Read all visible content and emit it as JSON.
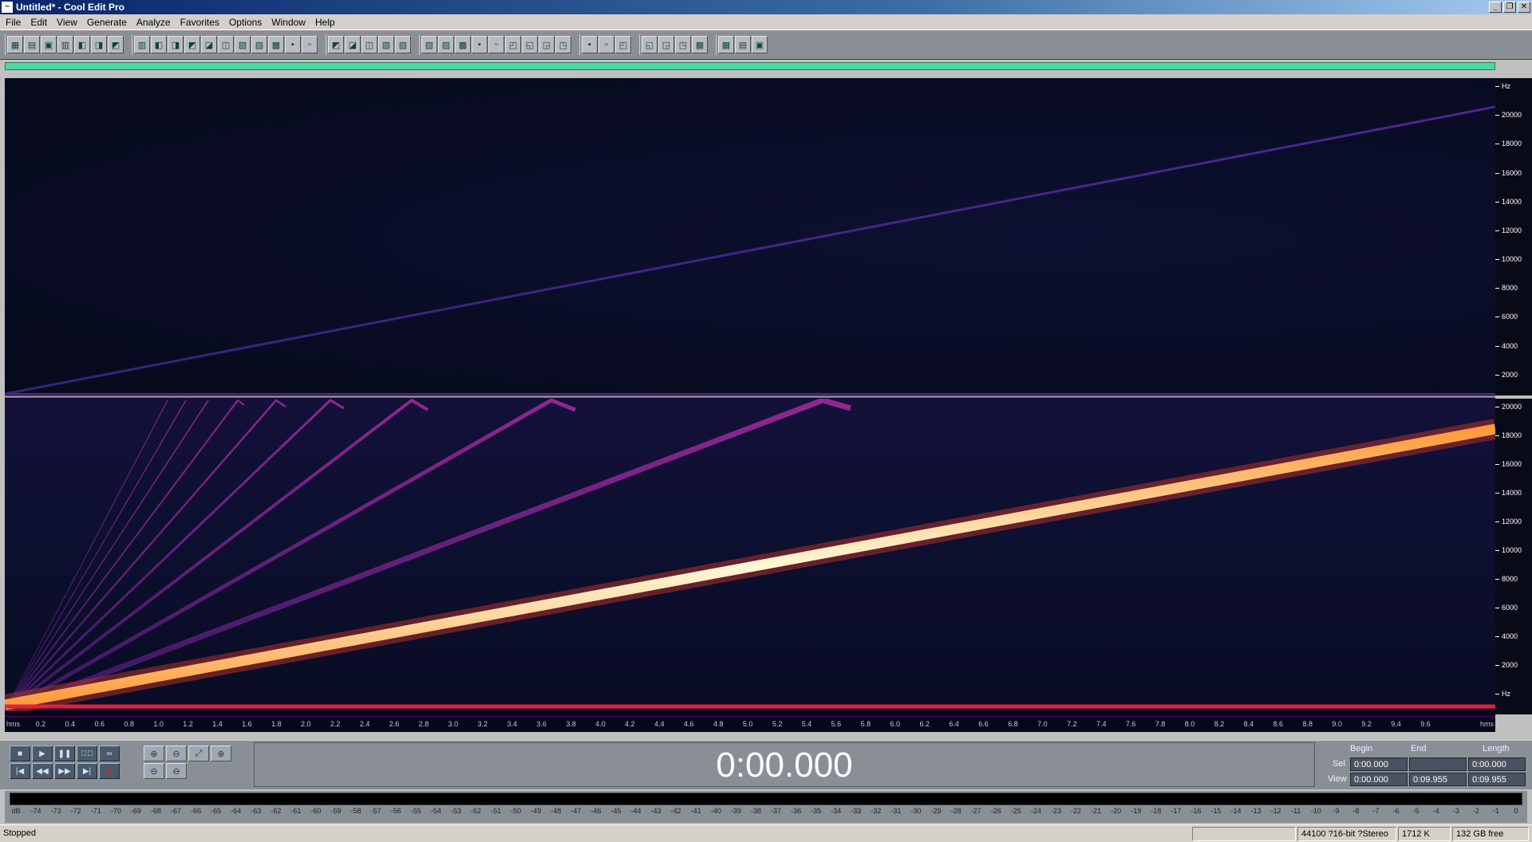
{
  "window": {
    "title": "Untitled* - Cool Edit Pro",
    "min": "_",
    "restore": "❐",
    "close": "✕"
  },
  "menu": [
    "File",
    "Edit",
    "View",
    "Generate",
    "Analyze",
    "Favorites",
    "Options",
    "Window",
    "Help"
  ],
  "toolbar": {
    "groups": [
      [
        "file-new",
        "open",
        "save",
        "save-all",
        "close-file",
        "insert",
        "mix-paste"
      ],
      [
        "undo",
        "redo",
        "repeat",
        "copy",
        "copy-new",
        "cut",
        "trim",
        "paste",
        "paste-new",
        "mix",
        "crossfade"
      ],
      [
        "waveform-view",
        "spectral-view",
        "pan-view",
        "phase-view",
        "stereo-view"
      ],
      [
        "cue-list",
        "play-list",
        "info",
        "play-loop",
        "zoom-view",
        "time-label",
        "frequency-analysis",
        "marker",
        "channel"
      ],
      [
        "wizard",
        "brainstorm",
        "help-context"
      ],
      [
        "fx-1",
        "fx-2",
        "fx-3",
        "fx-4"
      ],
      [
        "scripts",
        "brainstorm-2",
        "fullscreen"
      ]
    ]
  },
  "spectrogram": {
    "y_labels": [
      "Hz",
      "20000",
      "18000",
      "16000",
      "14000",
      "12000",
      "10000",
      "8000",
      "6000",
      "4000",
      "2000"
    ],
    "y_labels_bottom": [
      "20000",
      "18000",
      "16000",
      "14000",
      "12000",
      "10000",
      "8000",
      "6000",
      "4000",
      "2000",
      "Hz"
    ]
  },
  "x_axis": {
    "unit_left": "hms",
    "unit_right": "hms",
    "ticks": [
      "0.2",
      "0.4",
      "0.6",
      "0.8",
      "1.0",
      "1.2",
      "1.4",
      "1.6",
      "1.8",
      "2.0",
      "2.2",
      "2.4",
      "2.6",
      "2.8",
      "3.0",
      "3.2",
      "3.4",
      "3.6",
      "3.8",
      "4.0",
      "4.2",
      "4.4",
      "4.6",
      "4.8",
      "5.0",
      "5.2",
      "5.4",
      "5.6",
      "5.8",
      "6.0",
      "6.2",
      "6.4",
      "6.6",
      "6.8",
      "7.0",
      "7.2",
      "7.4",
      "7.6",
      "7.8",
      "8.0",
      "8.2",
      "8.4",
      "8.6",
      "8.8",
      "9.0",
      "9.2",
      "9.4",
      "9.6"
    ]
  },
  "transport": {
    "row1": [
      "■",
      "▶",
      "❚❚",
      "▶⃝",
      "∞"
    ],
    "row2": [
      "|◀",
      "◀◀",
      "▶▶",
      "▶|",
      "●"
    ],
    "zoom": [
      "⊕",
      "⊖",
      "⤢",
      "⊕",
      "⊖",
      "⊖"
    ]
  },
  "time_display": "0:00.000",
  "selection": {
    "headers": {
      "begin": "Begin",
      "end": "End",
      "length": "Length"
    },
    "sel": {
      "label": "Sel",
      "begin": "0:00.000",
      "end": "",
      "length": "0:00.000"
    },
    "view": {
      "label": "View",
      "begin": "0:00.000",
      "end": "0:09.955",
      "length": "0:09.955"
    }
  },
  "meter_scale": [
    "dB",
    "-74",
    "-73",
    "-72",
    "-71",
    "-70",
    "-69",
    "-68",
    "-67",
    "-66",
    "-65",
    "-64",
    "-63",
    "-62",
    "-61",
    "-60",
    "-59",
    "-58",
    "-57",
    "-56",
    "-55",
    "-54",
    "-53",
    "-52",
    "-51",
    "-50",
    "-49",
    "-48",
    "-47",
    "-46",
    "-45",
    "-44",
    "-43",
    "-42",
    "-41",
    "-40",
    "-39",
    "-38",
    "-37",
    "-36",
    "-35",
    "-34",
    "-33",
    "-32",
    "-31",
    "-30",
    "-29",
    "-28",
    "-27",
    "-26",
    "-25",
    "-24",
    "-23",
    "-22",
    "-21",
    "-20",
    "-19",
    "-18",
    "-17",
    "-16",
    "-15",
    "-14",
    "-13",
    "-12",
    "-11",
    "-10",
    "-9",
    "-8",
    "-7",
    "-6",
    "-5",
    "-4",
    "-3",
    "-2",
    "-1",
    "0"
  ],
  "status": {
    "state": "Stopped",
    "format": "44100 ?16-bit ?Stereo",
    "size": "1712 K",
    "free": "132 GB free"
  }
}
